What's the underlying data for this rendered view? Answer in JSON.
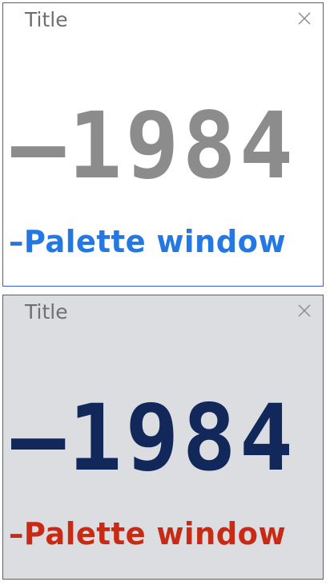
{
  "windows": [
    {
      "title": "Title",
      "close_icon": "close-icon",
      "year": "–1984",
      "label": "–Palette window",
      "colors": {
        "background": "#ffffff",
        "year": "#8c8c8c",
        "label": "#2478e3",
        "border": "#3b5bdb"
      }
    },
    {
      "title": "Title",
      "close_icon": "close-icon",
      "year": "–1984",
      "label": "–Palette window",
      "colors": {
        "background": "#dcdde1",
        "year": "#13285a",
        "label": "#c82a14",
        "border": "#3b5bdb"
      }
    }
  ]
}
